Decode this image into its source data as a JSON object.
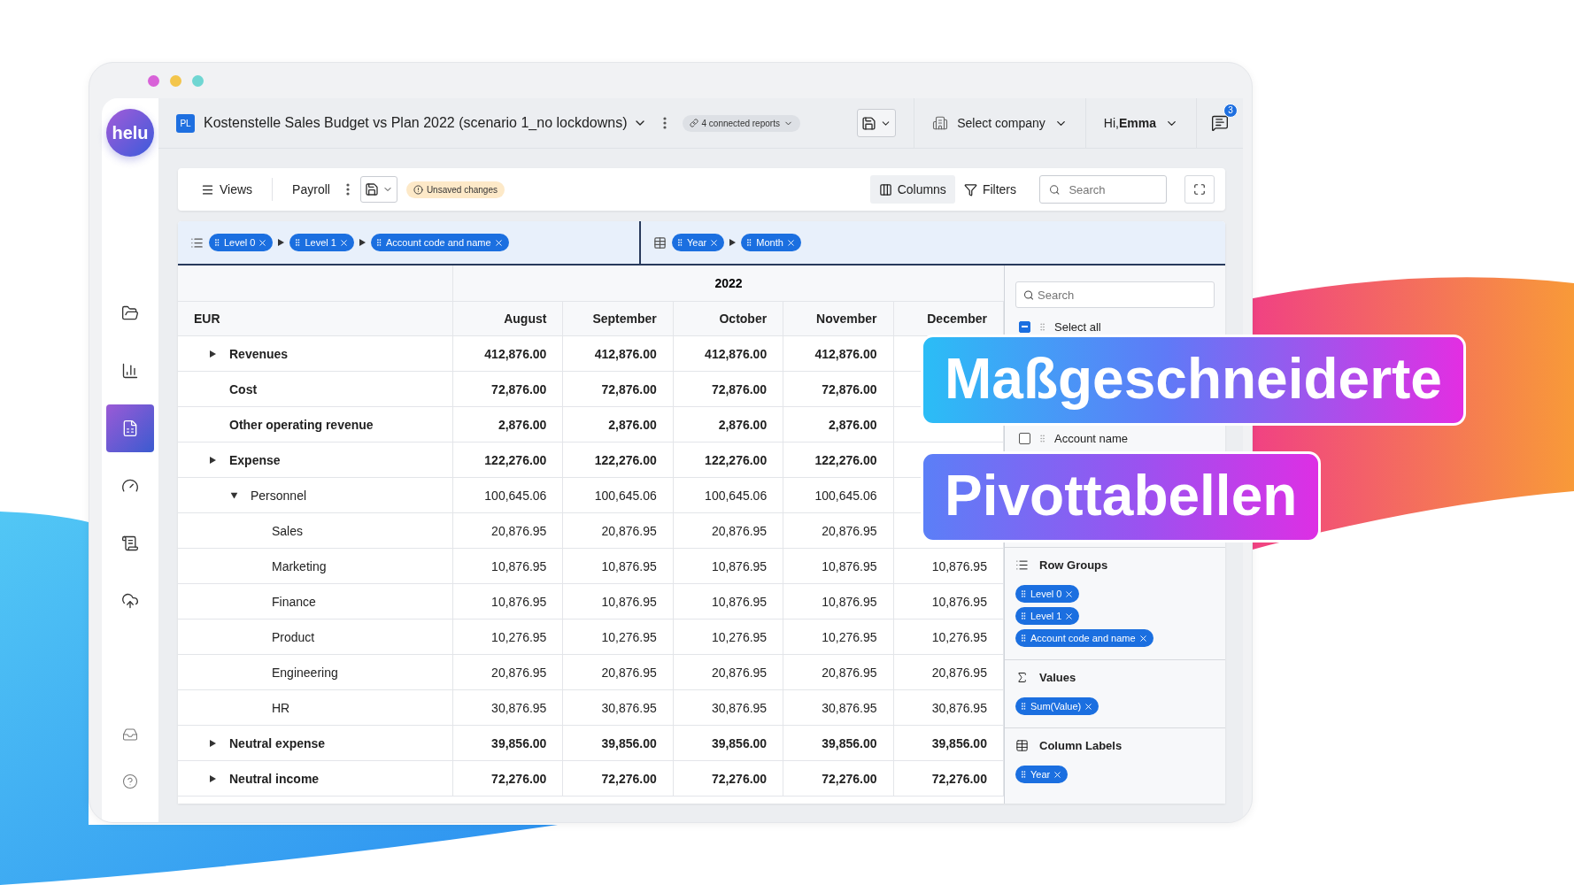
{
  "sidebar": {
    "logo": "helu",
    "items": [
      {
        "kind": "folder",
        "selected": false
      },
      {
        "kind": "chart",
        "selected": false
      },
      {
        "kind": "report",
        "selected": true
      },
      {
        "kind": "gauge",
        "selected": false
      },
      {
        "kind": "ledger",
        "selected": false
      },
      {
        "kind": "sync",
        "selected": false
      }
    ],
    "bottom_items": [
      {
        "kind": "tray"
      },
      {
        "kind": "help"
      }
    ]
  },
  "header": {
    "badge": "PL",
    "title": "Kostenstelle Sales Budget vs Plan 2022 (scenario 1_no lockdowns)",
    "connected_reports": "4 connected reports",
    "company": "Select company",
    "user": "Hi,**Emma**",
    "notifications": "3"
  },
  "toolbar": {
    "views": "Views",
    "view_name": "Payroll",
    "status": "Unsaved changes",
    "columns": {
      "label": "Columns",
      "selected": true
    },
    "filters": {
      "label": "Filters",
      "selected": false
    },
    "search": {
      "placeholder": "Search"
    }
  },
  "pivot_bar": {
    "row_chips": [
      "Level 0",
      "Level 1",
      "Account code and name"
    ],
    "column_chips": [
      "Year",
      "Month"
    ]
  },
  "table": {
    "year": "2022",
    "currency": "EUR",
    "columns": [
      "August",
      "September",
      "October",
      "November",
      "December"
    ],
    "rows": [
      {
        "label": "Revenues",
        "expanded": false,
        "values": [
          "412,876.00",
          "412,876.00",
          "412,876.00",
          "412,876.00"
        ]
      },
      {
        "label": "Cost",
        "values": [
          "72,876.00",
          "72,876.00",
          "72,876.00",
          "72,876.00"
        ]
      },
      {
        "label": "Other operating revenue",
        "values": [
          "2,876.00",
          "2,876.00",
          "2,876.00",
          "2,876.00"
        ]
      },
      {
        "label": "Expense",
        "expanded": false,
        "values": [
          "122,276.00",
          "122,276.00",
          "122,276.00",
          "122,276.00"
        ],
        "children": [
          {
            "label": "Personnel",
            "expanded": true,
            "values": [
              "100,645.06",
              "100,645.06",
              "100,645.06",
              "100,645.06"
            ],
            "children": [
              {
                "label": "Sales",
                "values": [
                  "20,876.95",
                  "20,876.95",
                  "20,876.95",
                  "20,876.95"
                ]
              },
              {
                "label": "Marketing",
                "values": [
                  "10,876.95",
                  "10,876.95",
                  "10,876.95",
                  "10,876.95",
                  "10,876.95"
                ]
              },
              {
                "label": "Finance",
                "values": [
                  "10,876.95",
                  "10,876.95",
                  "10,876.95",
                  "10,876.95",
                  "10,876.95"
                ]
              },
              {
                "label": "Product",
                "values": [
                  "10,276.95",
                  "10,276.95",
                  "10,276.95",
                  "10,276.95",
                  "10,276.95"
                ]
              },
              {
                "label": "Engineering",
                "values": [
                  "20,876.95",
                  "20,876.95",
                  "20,876.95",
                  "20,876.95",
                  "20,876.95"
                ]
              },
              {
                "label": "HR",
                "values": [
                  "30,876.95",
                  "30,876.95",
                  "30,876.95",
                  "30,876.95",
                  "30,876.95"
                ]
              }
            ]
          }
        ]
      },
      {
        "label": "Neutral expense",
        "expanded": false,
        "values": [
          "39,856.00",
          "39,856.00",
          "39,856.00",
          "39,856.00",
          "39,856.00"
        ]
      },
      {
        "label": "Neutral income",
        "expanded": false,
        "values": [
          "72,276.00",
          "72,276.00",
          "72,276.00",
          "72,276.00",
          "72,276.00"
        ]
      }
    ]
  },
  "panel": {
    "search": {
      "placeholder": "Search"
    },
    "filter_items": [
      {
        "label": "Select all",
        "checked": true,
        "partial": true
      },
      {
        "label": "Account name",
        "checked": false
      }
    ],
    "sections": [
      {
        "kind": "rows",
        "title": "Row Groups",
        "chips": [
          "Level 0",
          "Level 1",
          "Account code and name"
        ]
      },
      {
        "kind": "values",
        "title": "Values",
        "chips": [
          "Sum(Value)"
        ]
      },
      {
        "kind": "columns",
        "title": "Column Labels",
        "chips": [
          "Year"
        ]
      }
    ]
  },
  "banners": [
    "Maßgeschneiderte",
    "Pivottabellen"
  ]
}
